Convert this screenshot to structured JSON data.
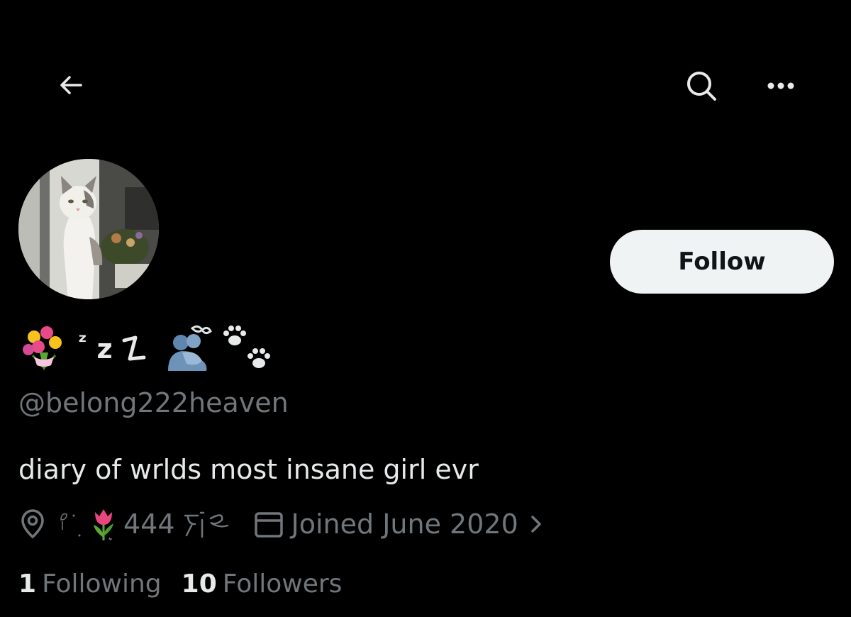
{
  "header": {
    "back_icon": "arrow-left-icon",
    "search_icon": "search-icon",
    "more_icon": "more-horizontal-icon"
  },
  "profile": {
    "display_name_z1": "ᶻ",
    "display_name_z2": "z",
    "display_name_z3": "𝗓",
    "handle": "@belong222heaven",
    "bio": "diary of wrlds most insane girl evr",
    "location_text": "444",
    "joined": "Joined June 2020",
    "follow_label": "Follow",
    "following_count": "1",
    "following_label": "Following",
    "followers_count": "10",
    "followers_label": "Followers"
  },
  "colors": {
    "background": "#000000",
    "primary_text": "#e7e9ea",
    "secondary_text": "#71767b",
    "follow_bg": "#eff3f4",
    "follow_text": "#0f1419"
  }
}
